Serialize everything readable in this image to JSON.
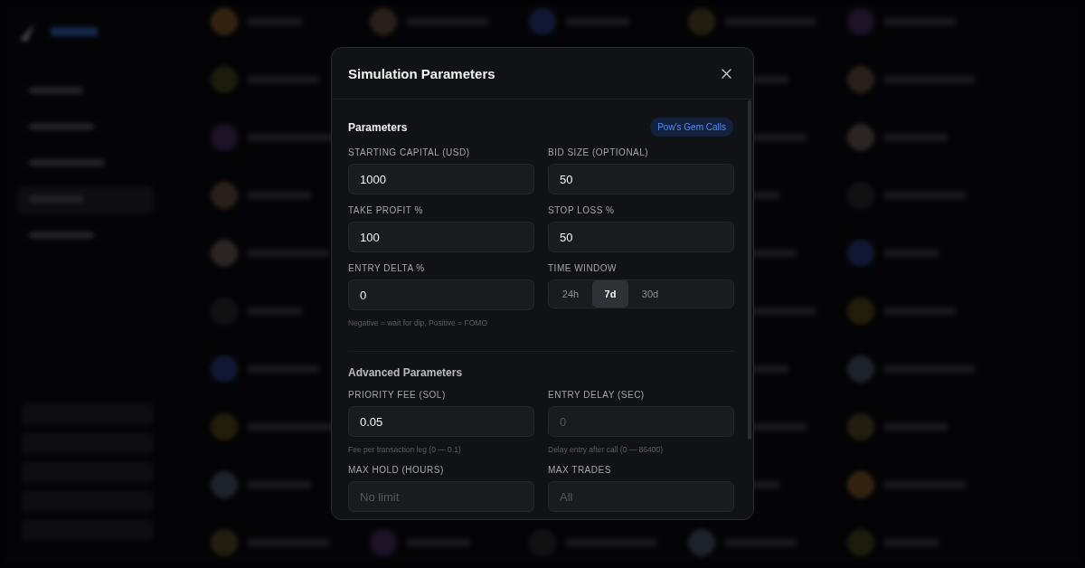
{
  "modal": {
    "title": "Simulation Parameters",
    "sections": [
      {
        "heading": "Parameters",
        "badge": "Pow's Gem Calls",
        "fields": [
          {
            "kind": "input",
            "label": "STARTING CAPITAL (USD)",
            "value": "1000"
          },
          {
            "kind": "input",
            "label": "BID SIZE (OPTIONAL)",
            "value": "50"
          },
          {
            "kind": "input",
            "label": "TAKE PROFIT %",
            "value": "100"
          },
          {
            "kind": "input",
            "label": "STOP LOSS %",
            "value": "50"
          },
          {
            "kind": "input",
            "label": "ENTRY DELTA %",
            "value": "0",
            "hint": "Negative = wait for dip, Positive = FOMO"
          },
          {
            "kind": "segmented",
            "label": "TIME WINDOW",
            "options": [
              {
                "label": "24h",
                "selected": false
              },
              {
                "label": "7d",
                "selected": true
              },
              {
                "label": "30d",
                "selected": false
              }
            ]
          }
        ]
      },
      {
        "heading": "Advanced Parameters",
        "fields": [
          {
            "kind": "input",
            "label": "PRIORITY FEE (SOL)",
            "value": "0.05",
            "hint": "Fee per transaction leg (0 — 0.1)"
          },
          {
            "kind": "input",
            "label": "ENTRY DELAY (SEC)",
            "placeholder": "0",
            "hint": "Delay entry after call (0 — 86400)"
          },
          {
            "kind": "input",
            "label": "MAX HOLD (HOURS)",
            "placeholder": "No limit"
          },
          {
            "kind": "input",
            "label": "MAX TRADES",
            "placeholder": "All"
          }
        ]
      }
    ]
  }
}
